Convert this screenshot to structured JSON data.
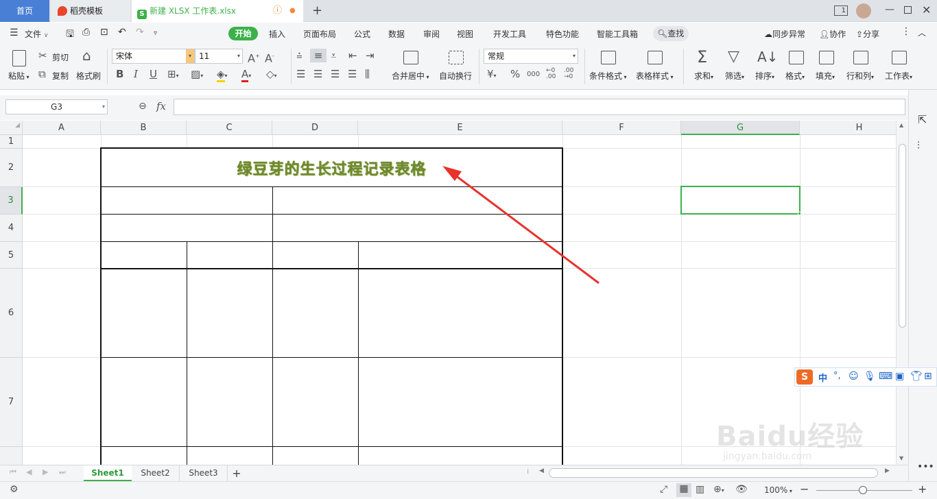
{
  "tabs": {
    "home": "首页",
    "template": "稻壳模板",
    "file": "新建 XLSX 工作表.xlsx",
    "new_tab": "+",
    "window_badge": "1"
  },
  "menubar": {
    "file": "文件",
    "items": [
      "开始",
      "插入",
      "页面布局",
      "公式",
      "数据",
      "审阅",
      "视图",
      "开发工具",
      "特色功能",
      "智能工具箱"
    ],
    "search": "查找",
    "sync": "同步异常",
    "collab": "协作",
    "share": "分享"
  },
  "ribbon": {
    "paste": "粘贴",
    "cut": "剪切",
    "copy": "复制",
    "format_painter": "格式刷",
    "font_name": "宋体",
    "font_size": "11",
    "bold": "B",
    "italic": "I",
    "underline": "U",
    "merge_center": "合并居中",
    "wrap_text": "自动换行",
    "number_format": "常规",
    "currency": "¥",
    "percent": "%",
    "thousands": "000",
    "conditional_format": "条件格式",
    "table_style": "表格样式",
    "sum": "求和",
    "filter": "筛选",
    "sort": "排序",
    "format": "格式",
    "fill": "填充",
    "rows_cols": "行和列",
    "worksheet": "工作表"
  },
  "formula_bar": {
    "cell_ref": "G3",
    "fx": "fx",
    "value": ""
  },
  "sheet": {
    "columns": [
      "A",
      "B",
      "C",
      "D",
      "E",
      "F",
      "G",
      "H"
    ],
    "rows": [
      "1",
      "2",
      "3",
      "4",
      "5",
      "6",
      "7"
    ],
    "title_cell": "绿豆芽的生长过程记录表格",
    "active_cell": "G3"
  },
  "sheets": [
    "Sheet1",
    "Sheet2",
    "Sheet3"
  ],
  "ime": {
    "lang": "中"
  },
  "status": {
    "zoom": "100%"
  },
  "watermark": {
    "text": "Baidu经验",
    "url": "jingyan.baidu.com"
  },
  "colors": {
    "accent_green": "#3cb14a",
    "home_tab_blue": "#4a7fd6",
    "title_green": "#6f8a2e",
    "arrow_red": "#e8322b"
  }
}
